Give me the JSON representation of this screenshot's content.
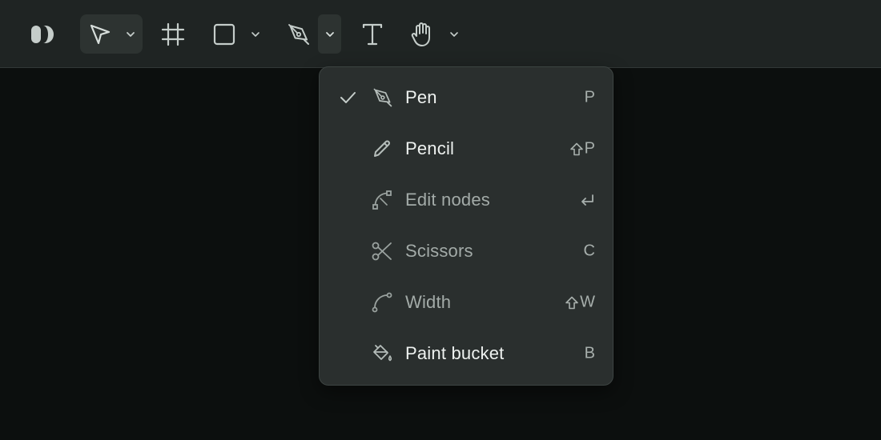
{
  "toolbar": {
    "tools": [
      {
        "name": "logo",
        "icon": "logo-icon"
      },
      {
        "name": "move",
        "icon": "arrow-pointer-icon",
        "active": true,
        "has_dropdown": true
      },
      {
        "name": "frame",
        "icon": "frame-hash-icon"
      },
      {
        "name": "shape",
        "icon": "rectangle-icon",
        "has_dropdown": true
      },
      {
        "name": "pen",
        "icon": "pen-nib-icon",
        "has_dropdown": true,
        "dropdown_open": true
      },
      {
        "name": "text",
        "icon": "text-t-icon"
      },
      {
        "name": "hand",
        "icon": "hand-icon",
        "has_dropdown": true
      }
    ]
  },
  "menu": {
    "items": [
      {
        "label": "Pen",
        "shortcut": "P",
        "icon": "pen-nib-icon",
        "checked": true,
        "enabled": true
      },
      {
        "label": "Pencil",
        "shortcut": "P",
        "shortcut_modifier": "shift-icon",
        "icon": "pencil-icon",
        "enabled": true
      },
      {
        "label": "Edit nodes",
        "shortcut": "",
        "shortcut_modifier": "return-icon",
        "icon": "edit-nodes-icon",
        "enabled": false
      },
      {
        "label": "Scissors",
        "shortcut": "C",
        "icon": "scissors-icon",
        "enabled": false
      },
      {
        "label": "Width",
        "shortcut": "W",
        "shortcut_modifier": "shift-icon",
        "icon": "width-curve-icon",
        "enabled": false
      },
      {
        "label": "Paint bucket",
        "shortcut": "B",
        "icon": "paint-bucket-icon",
        "enabled": true
      }
    ]
  },
  "colors": {
    "toolbar_bg": "#1f2423",
    "canvas_bg": "#0c0f0e",
    "menu_bg": "#2a2f2e",
    "text_primary": "#eef2f0",
    "text_dim": "#a3aba8"
  }
}
